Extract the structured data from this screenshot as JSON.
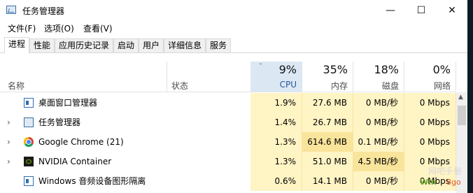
{
  "window": {
    "title": "任务管理器",
    "controls": {
      "minimize": "—",
      "maximize": "☐",
      "close": "✕"
    }
  },
  "menu": {
    "file": "文件(F)",
    "options": "选项(O)",
    "view": "查看(V)"
  },
  "tabs": [
    {
      "label": "进程",
      "active": true
    },
    {
      "label": "性能"
    },
    {
      "label": "应用历史记录"
    },
    {
      "label": "启动"
    },
    {
      "label": "用户"
    },
    {
      "label": "详细信息"
    },
    {
      "label": "服务"
    }
  ],
  "columns": {
    "name": "名称",
    "status": "状态",
    "cpu": {
      "percent": "9%",
      "label": "CPU",
      "sort": "˅"
    },
    "memory": {
      "percent": "35%",
      "label": "内存"
    },
    "disk": {
      "percent": "18%",
      "label": "磁盘"
    },
    "network": {
      "percent": "0%",
      "label": "网络"
    }
  },
  "processes": [
    {
      "name": "桌面窗口管理器",
      "cpu": "1.9%",
      "memory": "27.6 MB",
      "disk": "0 MB/秒",
      "network": "0 Mbps",
      "expandable": false,
      "icon": "desktop-window-manager-icon"
    },
    {
      "name": "任务管理器",
      "cpu": "1.4%",
      "memory": "26.7 MB",
      "disk": "0 MB/秒",
      "network": "0 Mbps",
      "expandable": true,
      "icon": "task-manager-icon"
    },
    {
      "name": "Google Chrome (21)",
      "cpu": "1.3%",
      "memory": "614.6 MB",
      "disk": "0.1 MB/秒",
      "network": "0 Mbps",
      "expandable": true,
      "icon": "chrome-icon"
    },
    {
      "name": "NVIDIA Container",
      "cpu": "1.3%",
      "memory": "51.0 MB",
      "disk": "4.5 MB/秒",
      "network": "0 Mbps",
      "expandable": true,
      "icon": "nvidia-icon"
    },
    {
      "name": "Windows 音频设备图形隔离",
      "cpu": "0.6%",
      "memory": "14.1 MB",
      "disk": "0 MB/秒",
      "network": "0 Mbps",
      "expandable": false,
      "icon": "audio-service-icon"
    }
  ],
  "watermark": {
    "line1": "网吧手册",
    "brand_left": "Win",
    "brand_right": "8go"
  },
  "colors": {
    "sorted_header": "#dbe8f4",
    "heat_low": "#fff4c4",
    "heat_high": "#f9e49b"
  }
}
